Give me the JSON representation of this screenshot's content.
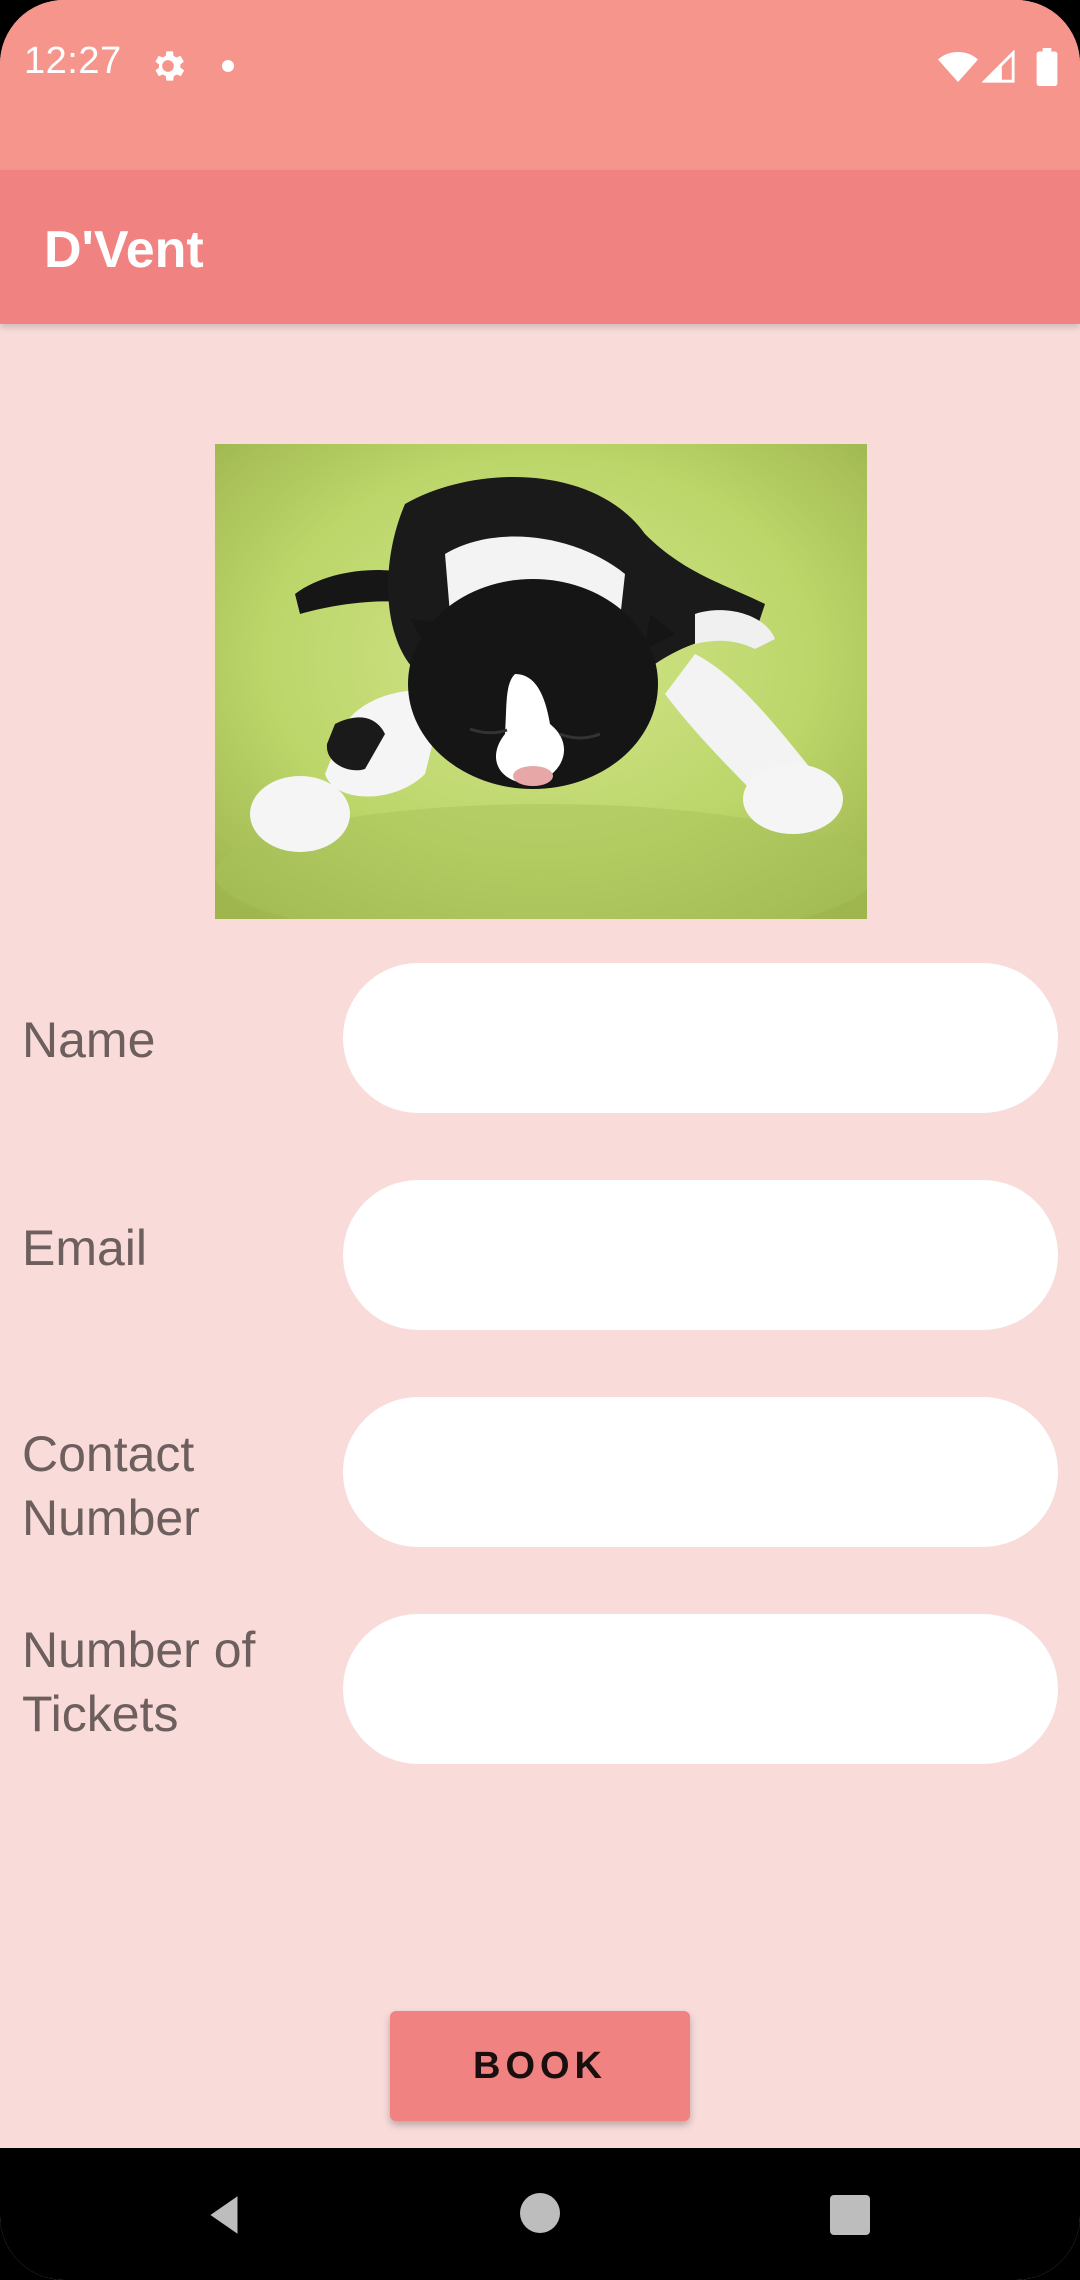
{
  "status_bar": {
    "time": "12:27",
    "icons": [
      "gear-icon",
      "notification-dot-icon",
      "wifi-icon",
      "signal-icon",
      "battery-icon"
    ]
  },
  "app_bar": {
    "title": "D'Vent"
  },
  "hero_image": {
    "subject": "cat-photo"
  },
  "form": {
    "name": {
      "label": "Name",
      "value": "",
      "placeholder": ""
    },
    "email": {
      "label": "Email",
      "value": "",
      "placeholder": ""
    },
    "contact": {
      "label_line1": "Contact",
      "label_line2": "Number",
      "value": "",
      "placeholder": ""
    },
    "tickets": {
      "label_line1": "Number of",
      "label_line2": "Tickets",
      "value": "",
      "placeholder": ""
    }
  },
  "book_button": {
    "label": "BOOK"
  },
  "navigation": {
    "icons": [
      "back-icon",
      "home-icon",
      "recents-icon"
    ]
  },
  "colors": {
    "status_bar": "#f6958b",
    "app_bar": "#f08281",
    "background": "#f9dcda",
    "input_background": "#ffffff",
    "label_text": "#6e5f5f",
    "button": "#f08281"
  }
}
